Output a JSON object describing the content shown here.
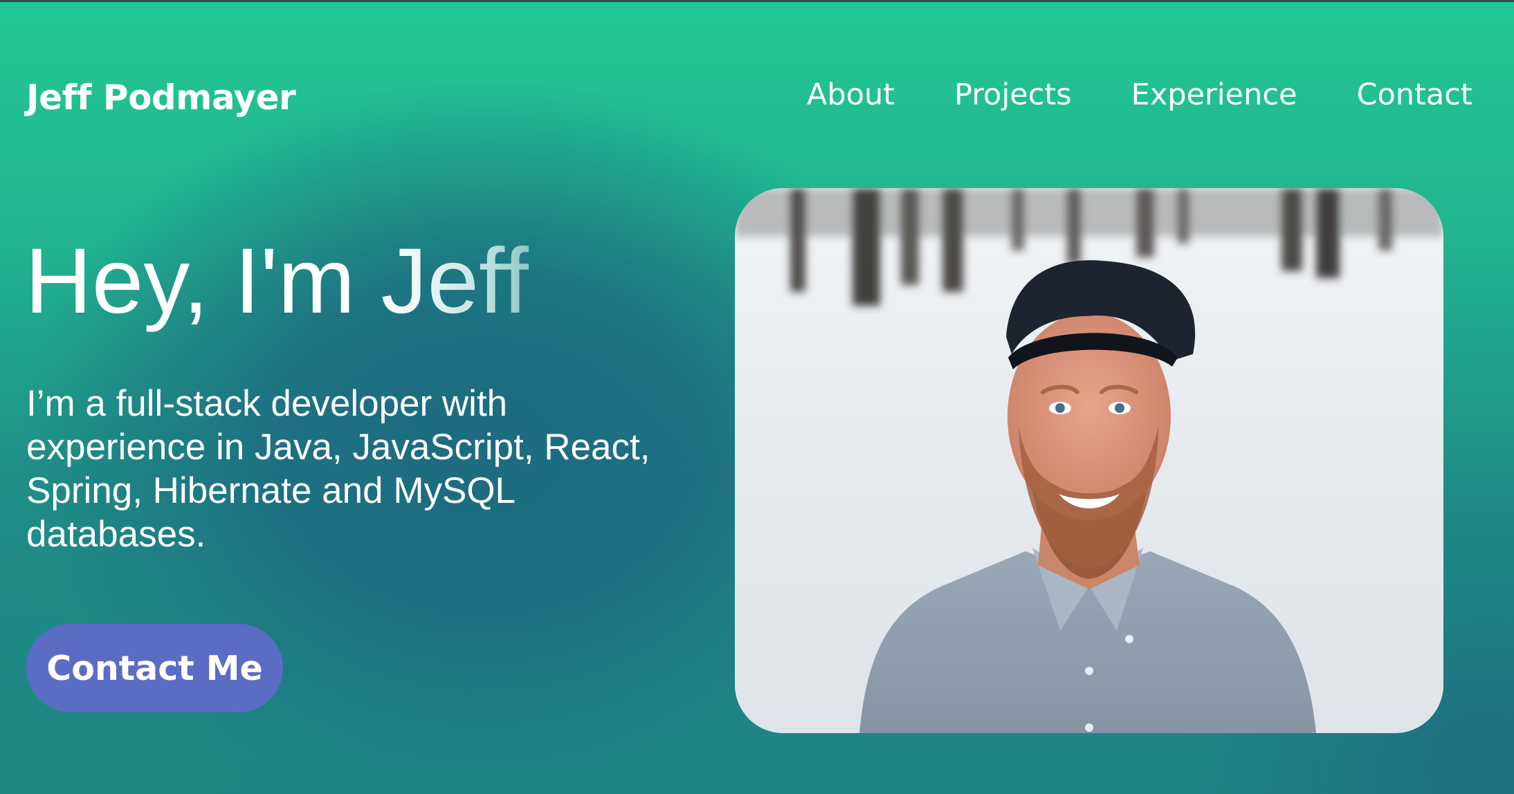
{
  "header": {
    "brand": "Jeff Podmayer",
    "nav": [
      {
        "label": "About"
      },
      {
        "label": "Projects"
      },
      {
        "label": "Experience"
      },
      {
        "label": "Contact"
      }
    ]
  },
  "hero": {
    "title_prefix": "Hey, I'm ",
    "title_name": "Jeff",
    "description": "I’m a full-stack developer with experience in Java, JavaScript, React, Spring, Hibernate and MySQL databases.",
    "cta_label": "Contact Me"
  },
  "colors": {
    "accent_green": "#22c794",
    "deep_teal": "#1d6b80",
    "button": "#5b6cc3",
    "text": "#ffffff"
  }
}
